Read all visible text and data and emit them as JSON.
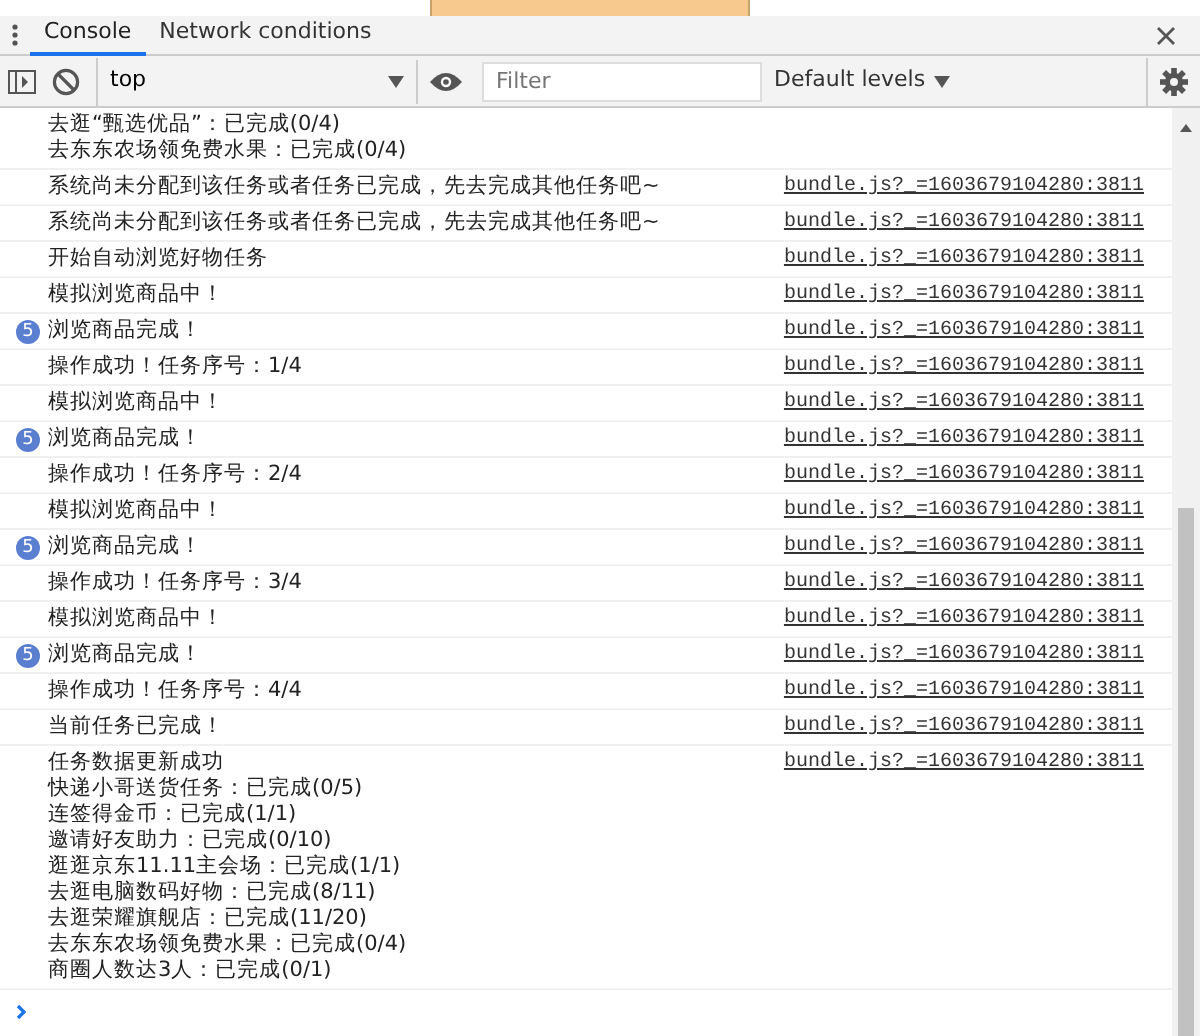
{
  "tabs": [
    {
      "label": "Console",
      "selected": true
    },
    {
      "label": "Network conditions",
      "selected": false
    }
  ],
  "toolbar": {
    "context": "top",
    "filter": {
      "placeholder": "Filter"
    },
    "levels": "Default levels"
  },
  "messages": [
    {
      "lines": [
        "去逛“甄选优品”：已完成(0/4)",
        "去东东农场领免费水果：已完成(0/4)"
      ]
    },
    {
      "lines": [
        "系统尚未分配到该任务或者任务已完成，先去完成其他任务吧~"
      ],
      "source": "bundle.js?_=1603679104280:3811"
    },
    {
      "lines": [
        "系统尚未分配到该任务或者任务已完成，先去完成其他任务吧~"
      ],
      "source": "bundle.js?_=1603679104280:3811"
    },
    {
      "lines": [
        "开始自动浏览好物任务"
      ],
      "source": "bundle.js?_=1603679104280:3811"
    },
    {
      "lines": [
        "模拟浏览商品中！"
      ],
      "source": "bundle.js?_=1603679104280:3811"
    },
    {
      "lines": [
        "浏览商品完成！"
      ],
      "source": "bundle.js?_=1603679104280:3811",
      "repeat": "5"
    },
    {
      "lines": [
        "操作成功！任务序号：1/4"
      ],
      "source": "bundle.js?_=1603679104280:3811"
    },
    {
      "lines": [
        "模拟浏览商品中！"
      ],
      "source": "bundle.js?_=1603679104280:3811"
    },
    {
      "lines": [
        "浏览商品完成！"
      ],
      "source": "bundle.js?_=1603679104280:3811",
      "repeat": "5"
    },
    {
      "lines": [
        "操作成功！任务序号：2/4"
      ],
      "source": "bundle.js?_=1603679104280:3811"
    },
    {
      "lines": [
        "模拟浏览商品中！"
      ],
      "source": "bundle.js?_=1603679104280:3811"
    },
    {
      "lines": [
        "浏览商品完成！"
      ],
      "source": "bundle.js?_=1603679104280:3811",
      "repeat": "5"
    },
    {
      "lines": [
        "操作成功！任务序号：3/4"
      ],
      "source": "bundle.js?_=1603679104280:3811"
    },
    {
      "lines": [
        "模拟浏览商品中！"
      ],
      "source": "bundle.js?_=1603679104280:3811"
    },
    {
      "lines": [
        "浏览商品完成！"
      ],
      "source": "bundle.js?_=1603679104280:3811",
      "repeat": "5"
    },
    {
      "lines": [
        "操作成功！任务序号：4/4"
      ],
      "source": "bundle.js?_=1603679104280:3811"
    },
    {
      "lines": [
        "当前任务已完成！"
      ],
      "source": "bundle.js?_=1603679104280:3811"
    },
    {
      "lines": [
        "任务数据更新成功",
        "快递小哥送货任务：已完成(0/5)",
        "连签得金币：已完成(1/1)",
        "邀请好友助力：已完成(0/10)",
        "逛逛京东11.11主会场：已完成(1/1)",
        "去逛电脑数码好物：已完成(8/11)",
        "去逛荣耀旗舰店：已完成(11/20)",
        "去东东农场领免费水果：已完成(0/4)",
        "商圈人数达3人：已完成(0/1)"
      ],
      "source": "bundle.js?_=1603679104280:3811"
    }
  ]
}
